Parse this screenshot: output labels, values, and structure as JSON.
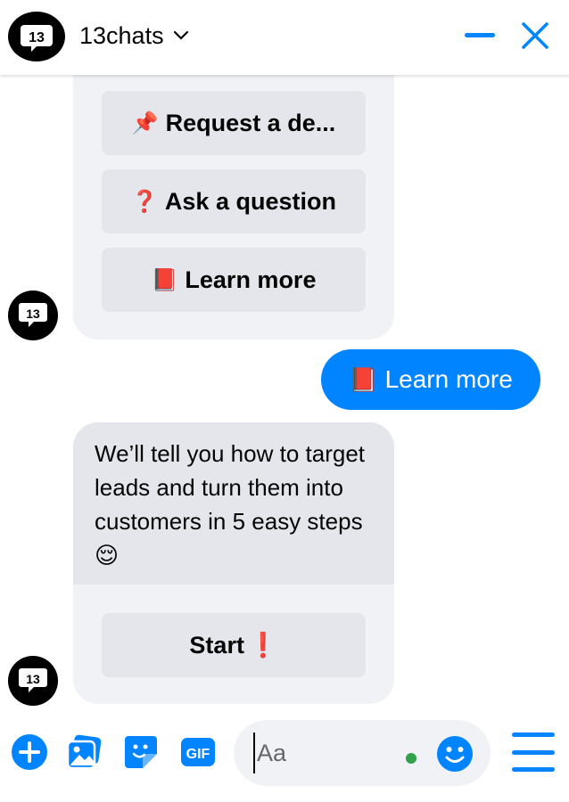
{
  "header": {
    "logo_text": "13",
    "title": "13chats"
  },
  "card1": {
    "buttons": [
      {
        "emoji": "📌",
        "label": "Request a de..."
      },
      {
        "emoji": "❓",
        "label": "Ask a question"
      },
      {
        "emoji": "📕",
        "label": "Learn more"
      }
    ]
  },
  "user_message": {
    "emoji": "📕",
    "text": "Learn more"
  },
  "bot_message": {
    "text": "We’ll tell you how to target leads and turn them into customers in 5 easy steps 😌",
    "button_label": "Start",
    "button_emoji": "❗"
  },
  "composer": {
    "placeholder": "Aa"
  },
  "colors": {
    "accent": "#0084ff",
    "bubble_bg": "#f0f2f5",
    "button_bg": "#e4e6eb",
    "typing": "#31a24c"
  },
  "icons": [
    "logo-13",
    "chevron-down-icon",
    "minimize-icon",
    "close-icon",
    "plus-circle-icon",
    "photo-icon",
    "sticker-icon",
    "gif-icon",
    "emoji-icon",
    "menu-icon"
  ]
}
